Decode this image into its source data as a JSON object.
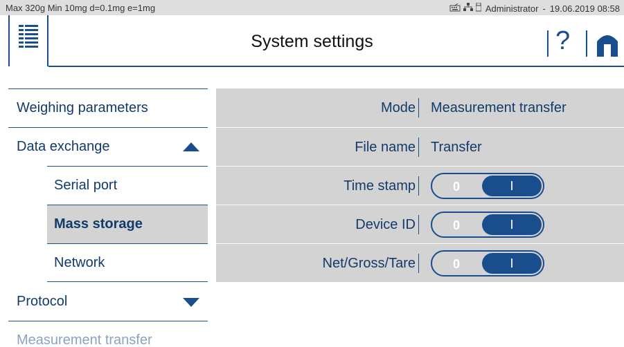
{
  "status_bar": {
    "capacity": "Max 320g  Min 10mg  d=0.1mg  e=1mg",
    "user": "Administrator",
    "separator": "-",
    "datetime": "19.06.2019 08:58",
    "icons": [
      "keyboard-icon",
      "network-icon",
      "usb-icon"
    ]
  },
  "header": {
    "title": "System settings",
    "help_label": "?"
  },
  "nav": {
    "items": [
      {
        "label": "Weighing parameters"
      },
      {
        "label": "Data exchange",
        "expanded": true
      },
      {
        "label": "Serial port"
      },
      {
        "label": "Mass storage",
        "active": true
      },
      {
        "label": "Network"
      },
      {
        "label": "Protocol",
        "expanded": false
      },
      {
        "label": "Measurement transfer"
      }
    ]
  },
  "settings": {
    "rows": [
      {
        "label": "Mode",
        "value": "Measurement transfer"
      },
      {
        "label": "File name",
        "value": "Transfer"
      },
      {
        "label": "Time stamp",
        "off_label": "0",
        "on_label": "I",
        "state": "on"
      },
      {
        "label": "Device ID",
        "off_label": "0",
        "on_label": "I",
        "state": "on"
      },
      {
        "label": "Net/Gross/Tare",
        "off_label": "0",
        "on_label": "I",
        "state": "on"
      }
    ]
  },
  "colors": {
    "accent": "#1a4d8c",
    "panel": "#d3d3d3",
    "statusbar": "#dedede"
  }
}
